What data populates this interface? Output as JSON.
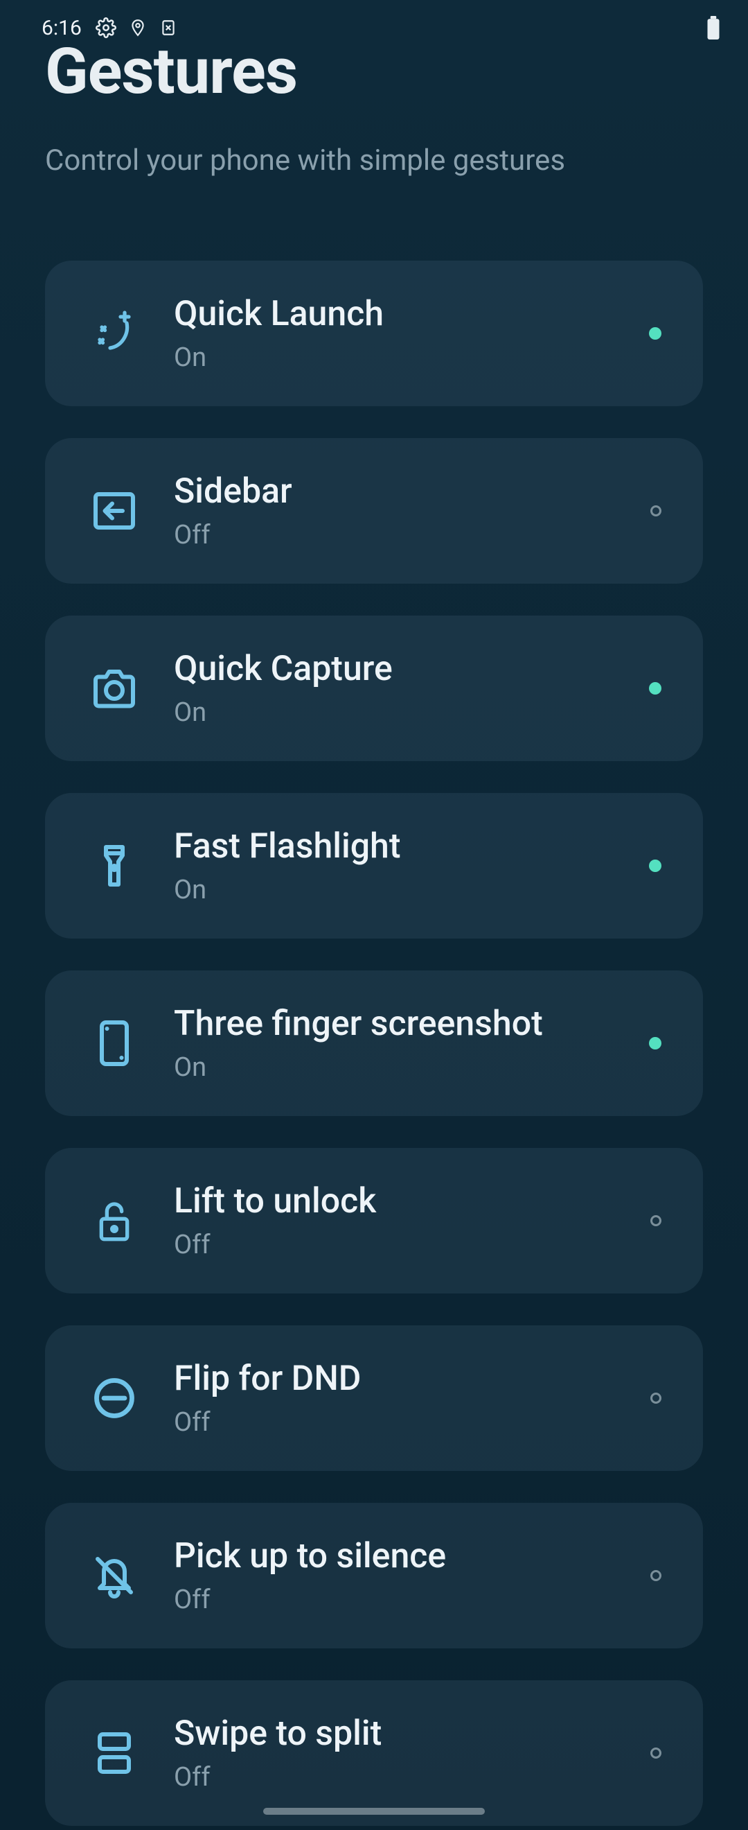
{
  "statusbar": {
    "time": "6:16"
  },
  "header": {
    "title": "Gestures",
    "subtitle": "Control your phone with simple gestures"
  },
  "items": [
    {
      "title": "Quick Launch",
      "status": "On",
      "on": true,
      "icon": "sparkle-moon"
    },
    {
      "title": "Sidebar",
      "status": "Off",
      "on": false,
      "icon": "sidebar-arrow"
    },
    {
      "title": "Quick Capture",
      "status": "On",
      "on": true,
      "icon": "camera"
    },
    {
      "title": "Fast Flashlight",
      "status": "On",
      "on": true,
      "icon": "flashlight"
    },
    {
      "title": "Three finger screenshot",
      "status": "On",
      "on": true,
      "icon": "phone"
    },
    {
      "title": "Lift to unlock",
      "status": "Off",
      "on": false,
      "icon": "lock"
    },
    {
      "title": "Flip for DND",
      "status": "Off",
      "on": false,
      "icon": "dnd"
    },
    {
      "title": "Pick up to silence",
      "status": "Off",
      "on": false,
      "icon": "bell-off"
    },
    {
      "title": "Swipe to split",
      "status": "Off",
      "on": false,
      "icon": "split"
    }
  ],
  "colors": {
    "accent_icon": "#6fc3e8",
    "indicator_on": "#54e0c0",
    "indicator_off": "#7a8f9a"
  }
}
